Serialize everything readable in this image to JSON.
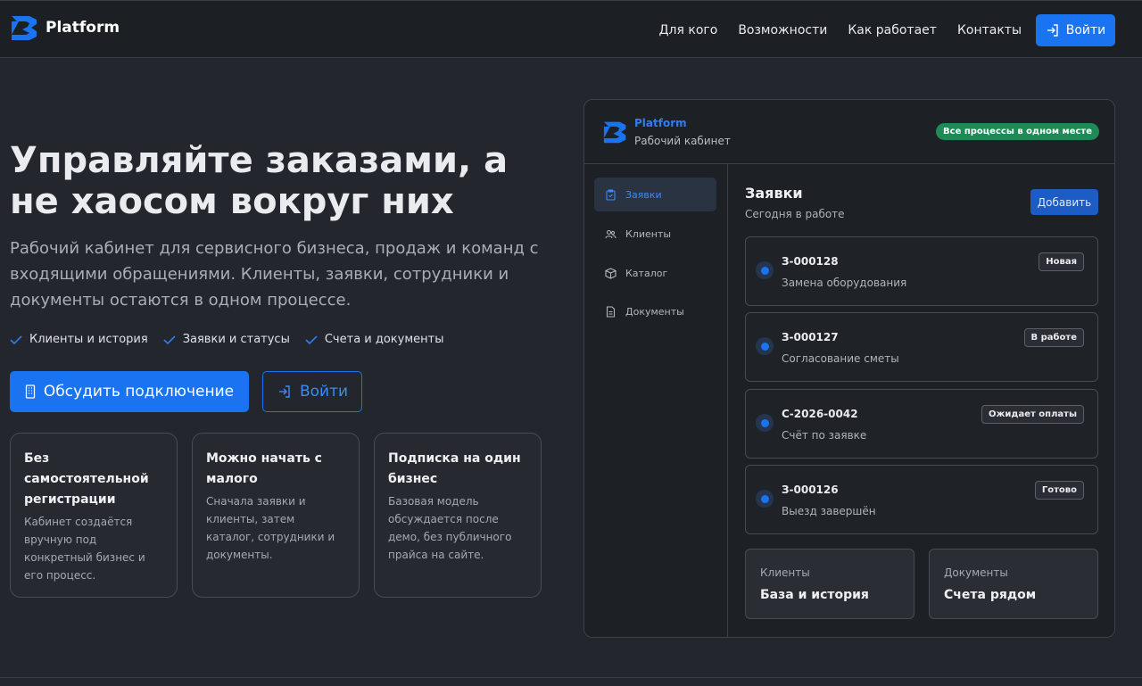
{
  "header": {
    "brand": "Platform",
    "nav": [
      "Для кого",
      "Возможности",
      "Как работает",
      "Контакты"
    ],
    "login_label": "Войти"
  },
  "hero": {
    "title": "Управляйте заказами, а не хаосом вокруг них",
    "subtitle": "Рабочий кабинет для сервисного бизнеса, продаж и команд с входящими обращениями. Клиенты, заявки, сотрудники и документы остаются в одном процессе.",
    "checks": [
      "Клиенты и история",
      "Заявки и статусы",
      "Счета и документы"
    ],
    "primary_button": "Обсудить подключение",
    "secondary_button": "Войти"
  },
  "features": [
    {
      "title": "Без самостоятельной регистрации",
      "text": "Кабинет создаётся вручную под конкретный бизнес и его процесс."
    },
    {
      "title": "Можно начать с малого",
      "text": "Сначала заявки и клиенты, затем каталог, сотрудники и документы."
    },
    {
      "title": "Подписка на один бизнес",
      "text": "Базовая модель обсуждается после демо, без публичного прайса на сайте."
    }
  ],
  "panel": {
    "brand": "Platform",
    "subtitle": "Рабочий кабинет",
    "badge": "Все процессы в одном месте",
    "sidebar": [
      {
        "label": "Заявки",
        "icon": "clipboard-icon",
        "active": true
      },
      {
        "label": "Клиенты",
        "icon": "users-icon",
        "active": false
      },
      {
        "label": "Каталог",
        "icon": "box-icon",
        "active": false
      },
      {
        "label": "Документы",
        "icon": "document-icon",
        "active": false
      }
    ],
    "main_title": "Заявки",
    "main_subtitle": "Сегодня в работе",
    "add_button": "Добавить",
    "orders": [
      {
        "id": "З-000128",
        "desc": "Замена оборудования",
        "status": "Новая"
      },
      {
        "id": "З-000127",
        "desc": "Согласование сметы",
        "status": "В работе"
      },
      {
        "id": "С-2026-0042",
        "desc": "Счёт по заявке",
        "status": "Ожидает оплаты"
      },
      {
        "id": "З-000126",
        "desc": "Выезд завершён",
        "status": "Готово"
      }
    ],
    "mini_cards": [
      {
        "label": "Клиенты",
        "value": "База и история"
      },
      {
        "label": "Документы",
        "value": "Счета рядом"
      }
    ]
  },
  "colors": {
    "accent": "#1a73f0",
    "badge_green": "#1f8a55",
    "background": "#23262c"
  }
}
